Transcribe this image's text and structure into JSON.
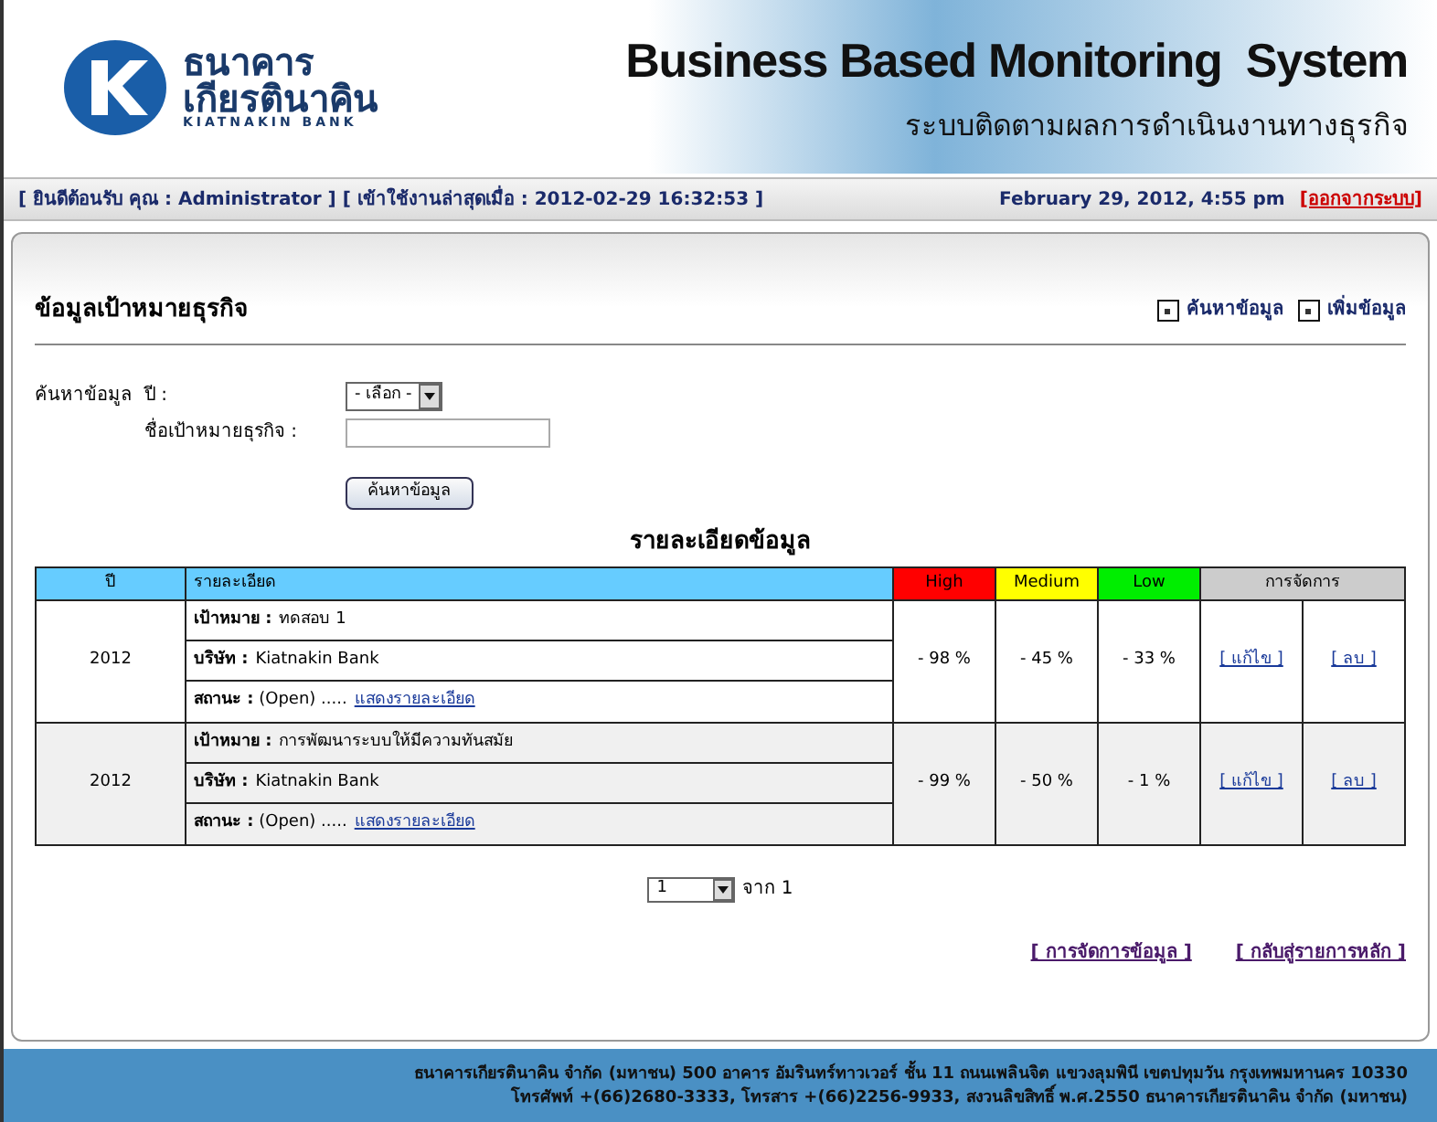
{
  "header": {
    "logo_thai_1": "ธนาคาร",
    "logo_thai_2": "เกียรตินาคิน",
    "logo_english": "KIATNAKIN BANK",
    "title": "Business Based Monitoring  System",
    "subtitle": "ระบบติดตามผลการดำเนินงานทางธุรกิจ"
  },
  "status_bar": {
    "welcome": "[ ยินดีต้อนรับ คุณ : Administrator ] [ เข้าใช้งานล่าสุดเมื่อ : 2012-02-29 16:32:53 ]",
    "datetime": "February 29, 2012, 4:55 pm",
    "logout": "[ออกจากระบบ]"
  },
  "page": {
    "title": "ข้อมูลเป้าหมายธุรกิจ",
    "actions": [
      "ค้นหาข้อมูล",
      "เพิ่มข้อมูล"
    ]
  },
  "search": {
    "label": "ค้นหาข้อมูล",
    "year_label": "ปี :",
    "year_value": "- เลือก -",
    "name_label": "ชื่อเป้าหมายธุรกิจ :",
    "button": "ค้นหาข้อมูล"
  },
  "table": {
    "caption": "รายละเอียดข้อมูล",
    "columns": [
      "ปี",
      "รายละเอียด",
      "High",
      "Medium",
      "Low",
      "การจัดการ"
    ],
    "rows": [
      {
        "year": "2012",
        "goal_label": "เป้าหมาย :",
        "goal": "ทดสอบ 1",
        "company_label": "บริษัท :",
        "company": "Kiatnakin Bank",
        "status_label": "สถานะ :",
        "status": "(Open) .....",
        "details_link": "แสดงรายละเอียด",
        "high": "- 98 %",
        "medium": "- 45 %",
        "low": "- 33 %",
        "edit": "[ แก้ไข ]",
        "delete": "[ ลบ ]"
      },
      {
        "year": "2012",
        "goal_label": "เป้าหมาย :",
        "goal": "การพัฒนาระบบให้มีความทันสมัย",
        "company_label": "บริษัท :",
        "company": "Kiatnakin Bank",
        "status_label": "สถานะ :",
        "status": "(Open) .....",
        "details_link": "แสดงรายละเอียด",
        "high": "- 99 %",
        "medium": "- 50 %",
        "low": "- 1 %",
        "edit": "[ แก้ไข ]",
        "delete": "[ ลบ ]"
      }
    ]
  },
  "pagination": {
    "page": "1",
    "of": "จาก 1"
  },
  "bottom_links": [
    "[ การจัดการข้อมูล ]",
    "[ กลับสู่รายการหลัก ]"
  ],
  "footer": [
    "ธนาคารเกียรตินาคิน จำกัด (มหาชน) 500 อาคาร อัมรินทร์ทาวเวอร์ ชั้น 11 ถนนเพลินจิต แขวงลุมพินี เขตปทุมวัน กรุงเทพมหานคร 10330",
    "โทรศัพท์ +(66)2680-3333, โทรสาร +(66)2256-9933, สงวนลิขสิทธิ์ พ.ศ.2550 ธนาคารเกียรตินาคิน จำกัด (มหาชน)"
  ]
}
